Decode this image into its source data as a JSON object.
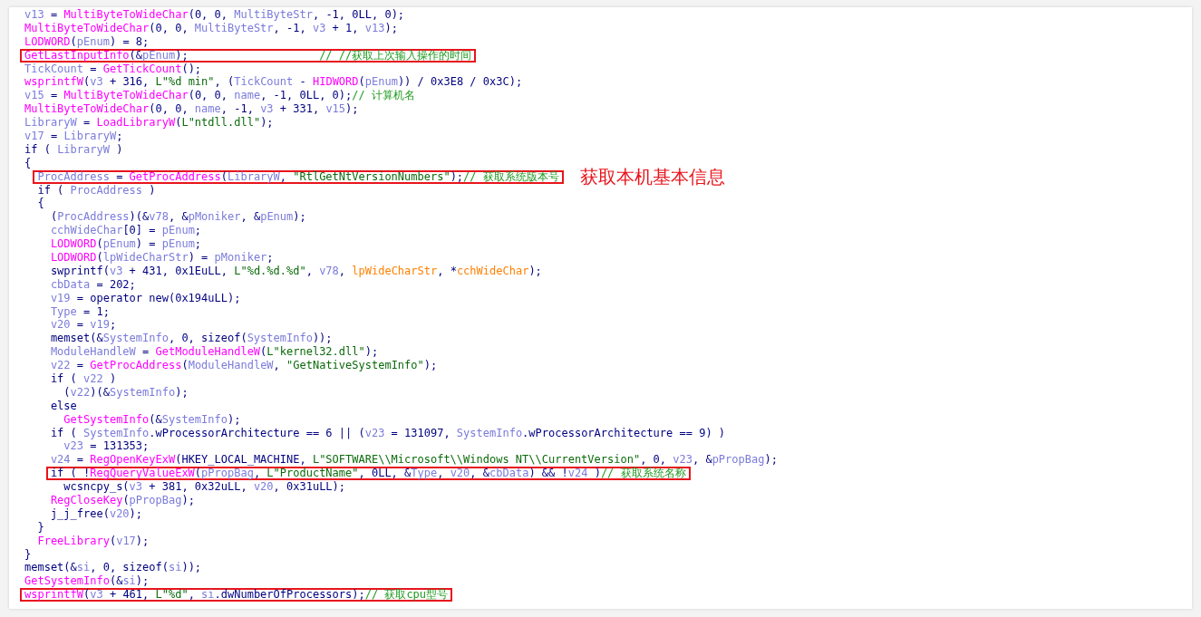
{
  "code": {
    "lines": [
      {
        "highlighted": false,
        "tokens": [
          {
            "kind": "var",
            "text": "v13"
          },
          {
            "kind": "plain",
            "text": " = "
          },
          {
            "kind": "func",
            "text": "MultiByteToWideChar"
          },
          {
            "kind": "plain",
            "text": "(0, 0, "
          },
          {
            "kind": "var",
            "text": "MultiByteStr"
          },
          {
            "kind": "plain",
            "text": ", -1, 0LL, 0);"
          }
        ]
      },
      {
        "highlighted": false,
        "tokens": [
          {
            "kind": "func",
            "text": "MultiByteToWideChar"
          },
          {
            "kind": "plain",
            "text": "(0, 0, "
          },
          {
            "kind": "var",
            "text": "MultiByteStr"
          },
          {
            "kind": "plain",
            "text": ", -1, "
          },
          {
            "kind": "var",
            "text": "v3"
          },
          {
            "kind": "plain",
            "text": " + 1, "
          },
          {
            "kind": "var",
            "text": "v13"
          },
          {
            "kind": "plain",
            "text": ");"
          }
        ]
      },
      {
        "highlighted": false,
        "tokens": [
          {
            "kind": "func",
            "text": "LODWORD"
          },
          {
            "kind": "plain",
            "text": "("
          },
          {
            "kind": "var",
            "text": "pEnum"
          },
          {
            "kind": "plain",
            "text": ") = 8;"
          }
        ]
      },
      {
        "highlighted": true,
        "tokens": [
          {
            "kind": "func",
            "text": "GetLastInputInfo"
          },
          {
            "kind": "plain",
            "text": "(&"
          },
          {
            "kind": "var",
            "text": "pEnum"
          },
          {
            "kind": "plain",
            "text": ");                    "
          },
          {
            "kind": "comment",
            "text": "// //获取上次输入操作的时间"
          }
        ]
      },
      {
        "highlighted": false,
        "tokens": [
          {
            "kind": "var",
            "text": "TickCount"
          },
          {
            "kind": "plain",
            "text": " = "
          },
          {
            "kind": "func",
            "text": "GetTickCount"
          },
          {
            "kind": "plain",
            "text": "();"
          }
        ]
      },
      {
        "highlighted": false,
        "tokens": [
          {
            "kind": "func",
            "text": "wsprintfW"
          },
          {
            "kind": "plain",
            "text": "("
          },
          {
            "kind": "var",
            "text": "v3"
          },
          {
            "kind": "plain",
            "text": " + 316, "
          },
          {
            "kind": "str",
            "text": "L\"%d min\""
          },
          {
            "kind": "plain",
            "text": ", ("
          },
          {
            "kind": "var",
            "text": "TickCount"
          },
          {
            "kind": "plain",
            "text": " - "
          },
          {
            "kind": "func",
            "text": "HIDWORD"
          },
          {
            "kind": "plain",
            "text": "("
          },
          {
            "kind": "var",
            "text": "pEnum"
          },
          {
            "kind": "plain",
            "text": ")) / 0x3E8 / 0x3C);"
          }
        ]
      },
      {
        "highlighted": false,
        "tokens": [
          {
            "kind": "var",
            "text": "v15"
          },
          {
            "kind": "plain",
            "text": " = "
          },
          {
            "kind": "func",
            "text": "MultiByteToWideChar"
          },
          {
            "kind": "plain",
            "text": "(0, 0, "
          },
          {
            "kind": "var",
            "text": "name"
          },
          {
            "kind": "plain",
            "text": ", -1, 0LL, 0);"
          },
          {
            "kind": "comment",
            "text": "// 计算机名"
          }
        ]
      },
      {
        "highlighted": false,
        "tokens": [
          {
            "kind": "func",
            "text": "MultiByteToWideChar"
          },
          {
            "kind": "plain",
            "text": "(0, 0, "
          },
          {
            "kind": "var",
            "text": "name"
          },
          {
            "kind": "plain",
            "text": ", -1, "
          },
          {
            "kind": "var",
            "text": "v3"
          },
          {
            "kind": "plain",
            "text": " + 331, "
          },
          {
            "kind": "var",
            "text": "v15"
          },
          {
            "kind": "plain",
            "text": ");"
          }
        ]
      },
      {
        "highlighted": false,
        "tokens": [
          {
            "kind": "var",
            "text": "LibraryW"
          },
          {
            "kind": "plain",
            "text": " = "
          },
          {
            "kind": "func",
            "text": "LoadLibraryW"
          },
          {
            "kind": "plain",
            "text": "("
          },
          {
            "kind": "str",
            "text": "L\"ntdll.dll\""
          },
          {
            "kind": "plain",
            "text": ");"
          }
        ]
      },
      {
        "highlighted": false,
        "tokens": [
          {
            "kind": "var",
            "text": "v17"
          },
          {
            "kind": "plain",
            "text": " = "
          },
          {
            "kind": "var",
            "text": "LibraryW"
          },
          {
            "kind": "plain",
            "text": ";"
          }
        ]
      },
      {
        "highlighted": false,
        "tokens": [
          {
            "kind": "plain",
            "text": "if ( "
          },
          {
            "kind": "var",
            "text": "LibraryW"
          },
          {
            "kind": "plain",
            "text": " )"
          }
        ]
      },
      {
        "highlighted": false,
        "tokens": [
          {
            "kind": "plain",
            "text": "{"
          }
        ],
        "children": [
          {
            "highlighted": true,
            "annotation": "获取本机基本信息",
            "tokens": [
              {
                "kind": "var",
                "text": "ProcAddress"
              },
              {
                "kind": "plain",
                "text": " = "
              },
              {
                "kind": "func",
                "text": "GetProcAddress"
              },
              {
                "kind": "plain",
                "text": "("
              },
              {
                "kind": "var",
                "text": "LibraryW"
              },
              {
                "kind": "plain",
                "text": ", "
              },
              {
                "kind": "str",
                "text": "\"RtlGetNtVersionNumbers\""
              },
              {
                "kind": "plain",
                "text": ");"
              },
              {
                "kind": "comment",
                "text": "// 获取系统版本号"
              }
            ]
          },
          {
            "highlighted": false,
            "tokens": [
              {
                "kind": "plain",
                "text": "if ( "
              },
              {
                "kind": "var",
                "text": "ProcAddress"
              },
              {
                "kind": "plain",
                "text": " )"
              }
            ]
          },
          {
            "highlighted": false,
            "tokens": [
              {
                "kind": "plain",
                "text": "{"
              }
            ],
            "children": [
              {
                "highlighted": false,
                "tokens": [
                  {
                    "kind": "plain",
                    "text": "("
                  },
                  {
                    "kind": "var",
                    "text": "ProcAddress"
                  },
                  {
                    "kind": "plain",
                    "text": ")(&"
                  },
                  {
                    "kind": "var",
                    "text": "v78"
                  },
                  {
                    "kind": "plain",
                    "text": ", &"
                  },
                  {
                    "kind": "var",
                    "text": "pMoniker"
                  },
                  {
                    "kind": "plain",
                    "text": ", &"
                  },
                  {
                    "kind": "var",
                    "text": "pEnum"
                  },
                  {
                    "kind": "plain",
                    "text": ");"
                  }
                ]
              },
              {
                "highlighted": false,
                "tokens": [
                  {
                    "kind": "var",
                    "text": "cchWideChar"
                  },
                  {
                    "kind": "plain",
                    "text": "[0] = "
                  },
                  {
                    "kind": "var",
                    "text": "pEnum"
                  },
                  {
                    "kind": "plain",
                    "text": ";"
                  }
                ]
              },
              {
                "highlighted": false,
                "tokens": [
                  {
                    "kind": "func",
                    "text": "LODWORD"
                  },
                  {
                    "kind": "plain",
                    "text": "("
                  },
                  {
                    "kind": "var",
                    "text": "pEnum"
                  },
                  {
                    "kind": "plain",
                    "text": ") = "
                  },
                  {
                    "kind": "var",
                    "text": "pEnum"
                  },
                  {
                    "kind": "plain",
                    "text": ";"
                  }
                ]
              },
              {
                "highlighted": false,
                "tokens": [
                  {
                    "kind": "func",
                    "text": "LODWORD"
                  },
                  {
                    "kind": "plain",
                    "text": "("
                  },
                  {
                    "kind": "var",
                    "text": "lpWideCharStr"
                  },
                  {
                    "kind": "plain",
                    "text": ") = "
                  },
                  {
                    "kind": "var",
                    "text": "pMoniker"
                  },
                  {
                    "kind": "plain",
                    "text": ";"
                  }
                ]
              },
              {
                "highlighted": false,
                "tokens": [
                  {
                    "kind": "plain",
                    "text": "swprintf("
                  },
                  {
                    "kind": "var",
                    "text": "v3"
                  },
                  {
                    "kind": "plain",
                    "text": " + 431, 0x1EuLL, "
                  },
                  {
                    "kind": "str",
                    "text": "L\"%d.%d.%d\""
                  },
                  {
                    "kind": "plain",
                    "text": ", "
                  },
                  {
                    "kind": "var",
                    "text": "v78"
                  },
                  {
                    "kind": "plain",
                    "text": ", "
                  },
                  {
                    "kind": "global",
                    "text": "lpWideCharStr"
                  },
                  {
                    "kind": "plain",
                    "text": ", *"
                  },
                  {
                    "kind": "global",
                    "text": "cchWideChar"
                  },
                  {
                    "kind": "plain",
                    "text": ");"
                  }
                ]
              },
              {
                "highlighted": false,
                "tokens": [
                  {
                    "kind": "var",
                    "text": "cbData"
                  },
                  {
                    "kind": "plain",
                    "text": " = 202;"
                  }
                ]
              },
              {
                "highlighted": false,
                "tokens": [
                  {
                    "kind": "var",
                    "text": "v19"
                  },
                  {
                    "kind": "plain",
                    "text": " = operator new(0x194uLL);"
                  }
                ]
              },
              {
                "highlighted": false,
                "tokens": [
                  {
                    "kind": "var",
                    "text": "Type"
                  },
                  {
                    "kind": "plain",
                    "text": " = 1;"
                  }
                ]
              },
              {
                "highlighted": false,
                "tokens": [
                  {
                    "kind": "var",
                    "text": "v20"
                  },
                  {
                    "kind": "plain",
                    "text": " = "
                  },
                  {
                    "kind": "var",
                    "text": "v19"
                  },
                  {
                    "kind": "plain",
                    "text": ";"
                  }
                ]
              },
              {
                "highlighted": false,
                "tokens": [
                  {
                    "kind": "plain",
                    "text": "memset(&"
                  },
                  {
                    "kind": "var",
                    "text": "SystemInfo"
                  },
                  {
                    "kind": "plain",
                    "text": ", 0, sizeof("
                  },
                  {
                    "kind": "var",
                    "text": "SystemInfo"
                  },
                  {
                    "kind": "plain",
                    "text": "));"
                  }
                ]
              },
              {
                "highlighted": false,
                "tokens": [
                  {
                    "kind": "var",
                    "text": "ModuleHandleW"
                  },
                  {
                    "kind": "plain",
                    "text": " = "
                  },
                  {
                    "kind": "func",
                    "text": "GetModuleHandleW"
                  },
                  {
                    "kind": "plain",
                    "text": "("
                  },
                  {
                    "kind": "str",
                    "text": "L\"kernel32.dll\""
                  },
                  {
                    "kind": "plain",
                    "text": ");"
                  }
                ]
              },
              {
                "highlighted": false,
                "tokens": [
                  {
                    "kind": "var",
                    "text": "v22"
                  },
                  {
                    "kind": "plain",
                    "text": " = "
                  },
                  {
                    "kind": "func",
                    "text": "GetProcAddress"
                  },
                  {
                    "kind": "plain",
                    "text": "("
                  },
                  {
                    "kind": "var",
                    "text": "ModuleHandleW"
                  },
                  {
                    "kind": "plain",
                    "text": ", "
                  },
                  {
                    "kind": "str",
                    "text": "\"GetNativeSystemInfo\""
                  },
                  {
                    "kind": "plain",
                    "text": ");"
                  }
                ]
              },
              {
                "highlighted": false,
                "tokens": [
                  {
                    "kind": "plain",
                    "text": "if ( "
                  },
                  {
                    "kind": "var",
                    "text": "v22"
                  },
                  {
                    "kind": "plain",
                    "text": " )"
                  }
                ],
                "children": [
                  {
                    "highlighted": false,
                    "tokens": [
                      {
                        "kind": "plain",
                        "text": "("
                      },
                      {
                        "kind": "var",
                        "text": "v22"
                      },
                      {
                        "kind": "plain",
                        "text": ")(&"
                      },
                      {
                        "kind": "var",
                        "text": "SystemInfo"
                      },
                      {
                        "kind": "plain",
                        "text": ");"
                      }
                    ]
                  }
                ]
              },
              {
                "highlighted": false,
                "tokens": [
                  {
                    "kind": "plain",
                    "text": "else"
                  }
                ],
                "children": [
                  {
                    "highlighted": false,
                    "tokens": [
                      {
                        "kind": "func",
                        "text": "GetSystemInfo"
                      },
                      {
                        "kind": "plain",
                        "text": "(&"
                      },
                      {
                        "kind": "var",
                        "text": "SystemInfo"
                      },
                      {
                        "kind": "plain",
                        "text": ");"
                      }
                    ]
                  }
                ]
              },
              {
                "highlighted": false,
                "tokens": [
                  {
                    "kind": "plain",
                    "text": "if ( "
                  },
                  {
                    "kind": "var",
                    "text": "SystemInfo"
                  },
                  {
                    "kind": "plain",
                    "text": ".wProcessorArchitecture == 6 || ("
                  },
                  {
                    "kind": "var",
                    "text": "v23"
                  },
                  {
                    "kind": "plain",
                    "text": " = 131097, "
                  },
                  {
                    "kind": "var",
                    "text": "SystemInfo"
                  },
                  {
                    "kind": "plain",
                    "text": ".wProcessorArchitecture == 9) )"
                  }
                ],
                "children": [
                  {
                    "highlighted": false,
                    "tokens": [
                      {
                        "kind": "var",
                        "text": "v23"
                      },
                      {
                        "kind": "plain",
                        "text": " = 131353;"
                      }
                    ]
                  }
                ]
              },
              {
                "highlighted": false,
                "tokens": [
                  {
                    "kind": "var",
                    "text": "v24"
                  },
                  {
                    "kind": "plain",
                    "text": " = "
                  },
                  {
                    "kind": "func",
                    "text": "RegOpenKeyExW"
                  },
                  {
                    "kind": "plain",
                    "text": "(HKEY_LOCAL_MACHINE, "
                  },
                  {
                    "kind": "str",
                    "text": "L\"SOFTWARE\\\\Microsoft\\\\Windows NT\\\\CurrentVersion\""
                  },
                  {
                    "kind": "plain",
                    "text": ", 0, "
                  },
                  {
                    "kind": "var",
                    "text": "v23"
                  },
                  {
                    "kind": "plain",
                    "text": ", &"
                  },
                  {
                    "kind": "var",
                    "text": "pPropBag"
                  },
                  {
                    "kind": "plain",
                    "text": ");"
                  }
                ]
              },
              {
                "highlighted": true,
                "tokens": [
                  {
                    "kind": "plain",
                    "text": "if ( !"
                  },
                  {
                    "kind": "func",
                    "text": "RegQueryValueExW"
                  },
                  {
                    "kind": "plain",
                    "text": "("
                  },
                  {
                    "kind": "var",
                    "text": "pPropBag"
                  },
                  {
                    "kind": "plain",
                    "text": ", "
                  },
                  {
                    "kind": "str",
                    "text": "L\"ProductName\""
                  },
                  {
                    "kind": "plain",
                    "text": ", 0LL, &"
                  },
                  {
                    "kind": "var",
                    "text": "Type"
                  },
                  {
                    "kind": "plain",
                    "text": ", "
                  },
                  {
                    "kind": "var",
                    "text": "v20"
                  },
                  {
                    "kind": "plain",
                    "text": ", &"
                  },
                  {
                    "kind": "var",
                    "text": "cbData"
                  },
                  {
                    "kind": "plain",
                    "text": ") && !"
                  },
                  {
                    "kind": "var",
                    "text": "v24"
                  },
                  {
                    "kind": "plain",
                    "text": " )"
                  },
                  {
                    "kind": "comment",
                    "text": "// 获取系统名称"
                  }
                ],
                "children": [
                  {
                    "highlighted": false,
                    "tokens": [
                      {
                        "kind": "plain",
                        "text": "wcsncpy_s("
                      },
                      {
                        "kind": "var",
                        "text": "v3"
                      },
                      {
                        "kind": "plain",
                        "text": " + 381, 0x32uLL, "
                      },
                      {
                        "kind": "var",
                        "text": "v20"
                      },
                      {
                        "kind": "plain",
                        "text": ", 0x31uLL);"
                      }
                    ]
                  }
                ]
              },
              {
                "highlighted": false,
                "tokens": [
                  {
                    "kind": "func",
                    "text": "RegCloseKey"
                  },
                  {
                    "kind": "plain",
                    "text": "("
                  },
                  {
                    "kind": "var",
                    "text": "pPropBag"
                  },
                  {
                    "kind": "plain",
                    "text": ");"
                  }
                ]
              },
              {
                "highlighted": false,
                "tokens": [
                  {
                    "kind": "plain",
                    "text": "j_j_free("
                  },
                  {
                    "kind": "var",
                    "text": "v20"
                  },
                  {
                    "kind": "plain",
                    "text": ");"
                  }
                ]
              }
            ]
          },
          {
            "highlighted": false,
            "tokens": [
              {
                "kind": "plain",
                "text": "}"
              }
            ]
          },
          {
            "highlighted": false,
            "tokens": [
              {
                "kind": "func",
                "text": "FreeLibrary"
              },
              {
                "kind": "plain",
                "text": "("
              },
              {
                "kind": "var",
                "text": "v17"
              },
              {
                "kind": "plain",
                "text": ");"
              }
            ]
          }
        ]
      },
      {
        "highlighted": false,
        "tokens": [
          {
            "kind": "plain",
            "text": "}"
          }
        ]
      },
      {
        "highlighted": false,
        "tokens": [
          {
            "kind": "plain",
            "text": "memset(&"
          },
          {
            "kind": "var",
            "text": "si"
          },
          {
            "kind": "plain",
            "text": ", 0, sizeof("
          },
          {
            "kind": "var",
            "text": "si"
          },
          {
            "kind": "plain",
            "text": "));"
          }
        ]
      },
      {
        "highlighted": false,
        "tokens": [
          {
            "kind": "func",
            "text": "GetSystemInfo"
          },
          {
            "kind": "plain",
            "text": "(&"
          },
          {
            "kind": "var",
            "text": "si"
          },
          {
            "kind": "plain",
            "text": ");"
          }
        ]
      },
      {
        "highlighted": true,
        "tokens": [
          {
            "kind": "func",
            "text": "wsprintfW"
          },
          {
            "kind": "plain",
            "text": "("
          },
          {
            "kind": "var",
            "text": "v3"
          },
          {
            "kind": "plain",
            "text": " + 461, "
          },
          {
            "kind": "str",
            "text": "L\"%d\""
          },
          {
            "kind": "plain",
            "text": ", "
          },
          {
            "kind": "var",
            "text": "si"
          },
          {
            "kind": "plain",
            "text": ".dwNumberOfProcessors);"
          },
          {
            "kind": "comment",
            "text": "// 获取cpu型号"
          }
        ]
      }
    ]
  }
}
